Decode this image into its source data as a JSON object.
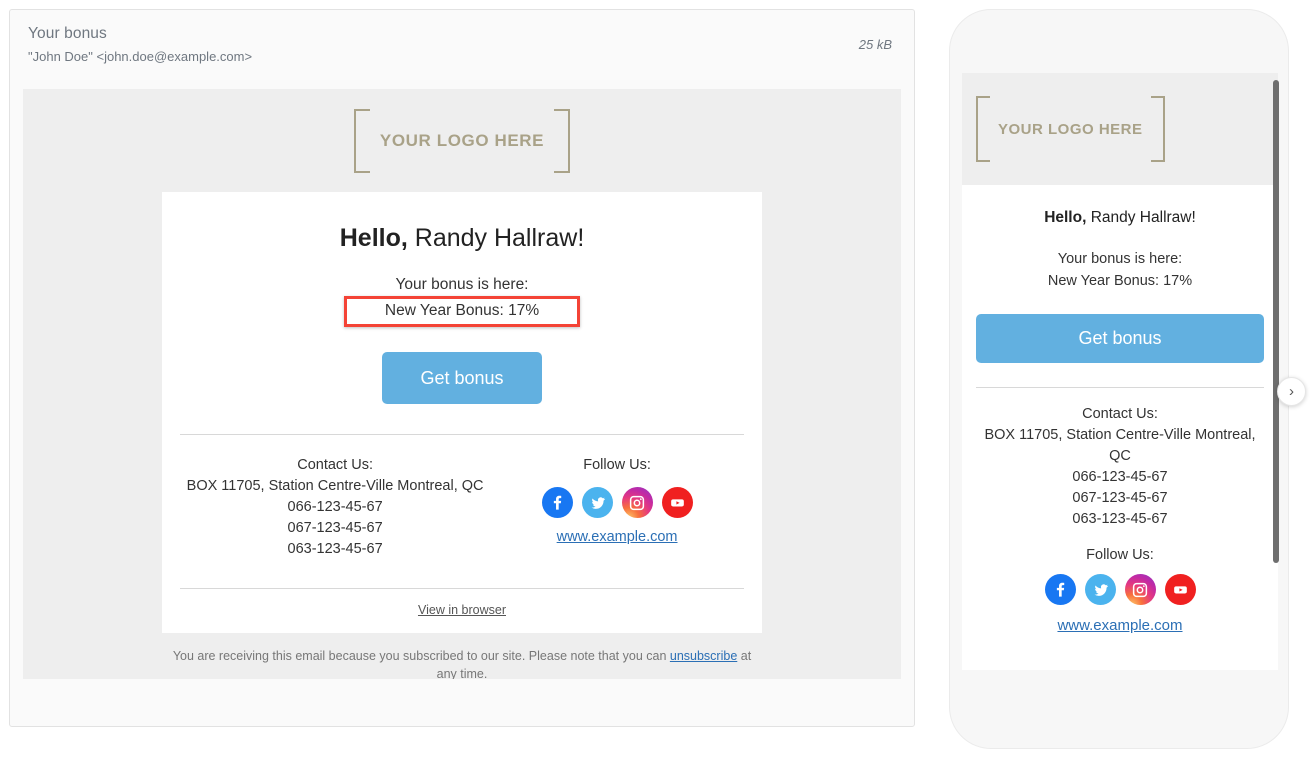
{
  "email": {
    "subject": "Your bonus",
    "from": "\"John Doe\" <john.doe@example.com>",
    "size": "25 kB",
    "logo_text": "YOUR LOGO HERE",
    "greeting_bold": "Hello,",
    "greeting_name": " Randy Hallraw!",
    "bonus_label": "Your bonus is here:",
    "bonus_value": "New Year Bonus: 17%",
    "cta_label": "Get bonus",
    "contact_title": "Contact Us:",
    "address": "BOX 11705, Station Centre-Ville Montreal, QC",
    "address_mobile_line1": "BOX 11705, Station Centre-Ville Montreal,",
    "address_mobile_line2": "QC",
    "phones": [
      "066-123-45-67",
      "067-123-45-67",
      "063-123-45-67"
    ],
    "follow_title": "Follow Us:",
    "site_link": "www.example.com",
    "view_in_browser": "View in browser",
    "disclaimer_before": "You are receiving this email because you subscribed to our site. Please note that you can ",
    "disclaimer_link": "unsubscribe",
    "disclaimer_after": " at any time.",
    "social": [
      {
        "name": "facebook",
        "color": "#1877f2"
      },
      {
        "name": "twitter",
        "color": "#4bb3ee"
      },
      {
        "name": "instagram",
        "color": "#e5397f"
      },
      {
        "name": "youtube",
        "color": "#f02020"
      }
    ]
  },
  "controls": {
    "next_arrow": "›"
  },
  "colors": {
    "cta": "#62b0e0",
    "highlight_border": "#f44336",
    "link": "#2b6fb5",
    "logo": "#a9a288",
    "body_bg": "#eeeeee"
  }
}
